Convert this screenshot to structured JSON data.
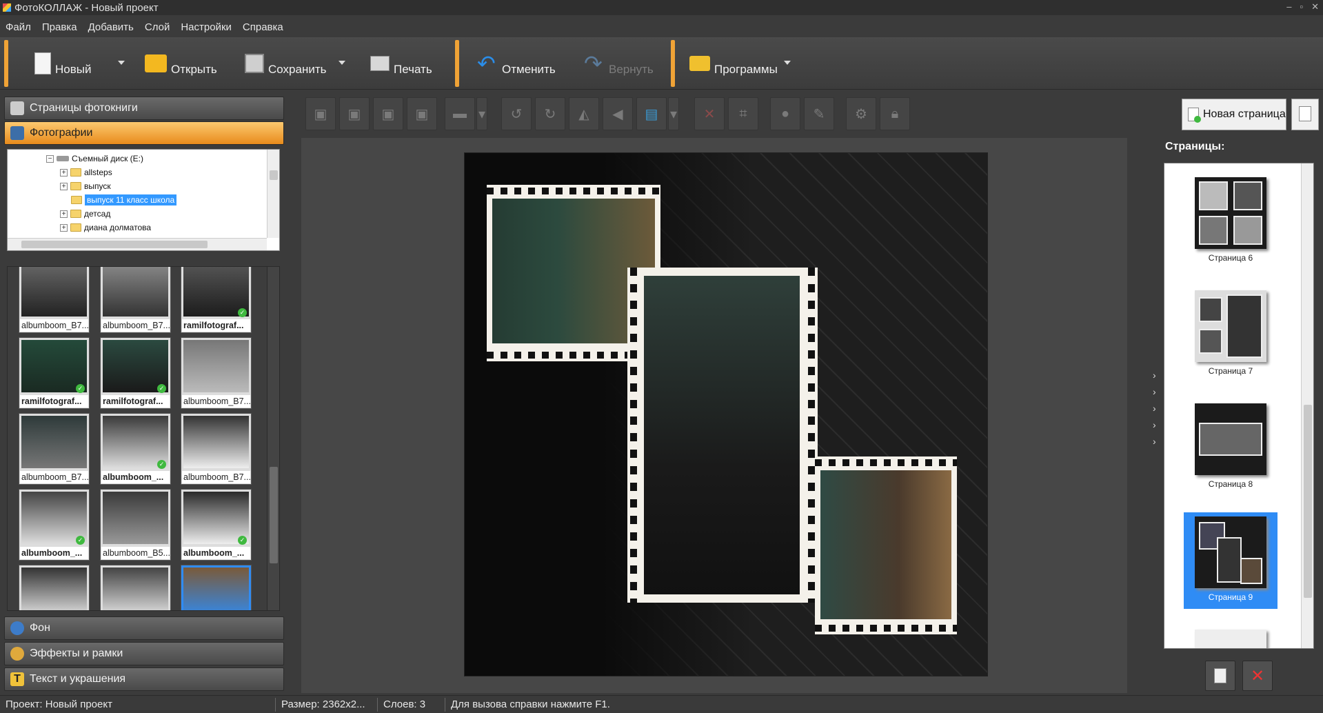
{
  "window": {
    "title": "ФотоКОЛЛАЖ - Новый проект"
  },
  "menu": [
    "Файл",
    "Правка",
    "Добавить",
    "Слой",
    "Настройки",
    "Справка"
  ],
  "toolbar": {
    "new": "Новый",
    "open": "Открыть",
    "save": "Сохранить",
    "print": "Печать",
    "undo": "Отменить",
    "redo": "Вернуть",
    "programs": "Программы"
  },
  "left_panel": {
    "sections": {
      "pages": "Страницы фотокниги",
      "photos": "Фотографии",
      "background": "Фон",
      "effects": "Эффекты и рамки",
      "text": "Текст и украшения"
    },
    "tree": {
      "drive": "Съемный диск (E:)",
      "folders": [
        "allsteps",
        "выпуск",
        "выпуск 11 класс школа",
        "детсад",
        "диана долматова"
      ],
      "selected": "выпуск 11 класс школа"
    },
    "thumbnails": [
      {
        "caption": "albumboom_B7...",
        "bold": false,
        "used": false
      },
      {
        "caption": "albumboom_B7...",
        "bold": false,
        "used": false
      },
      {
        "caption": "ramilfotograf...",
        "bold": true,
        "used": true
      },
      {
        "caption": "ramilfotograf...",
        "bold": true,
        "used": true
      },
      {
        "caption": "ramilfotograf...",
        "bold": true,
        "used": true
      },
      {
        "caption": "albumboom_B7...",
        "bold": false,
        "used": false
      },
      {
        "caption": "albumboom_B7...",
        "bold": false,
        "used": false
      },
      {
        "caption": "albumboom_...",
        "bold": true,
        "used": true
      },
      {
        "caption": "albumboom_B7...",
        "bold": false,
        "used": false
      },
      {
        "caption": "albumboom_...",
        "bold": true,
        "used": true
      },
      {
        "caption": "albumboom_B5...",
        "bold": false,
        "used": false
      },
      {
        "caption": "albumboom_...",
        "bold": true,
        "used": true
      },
      {
        "caption": "",
        "bold": false,
        "used": true
      },
      {
        "caption": "",
        "bold": false,
        "used": true
      },
      {
        "caption": "",
        "bold": false,
        "used": true
      }
    ]
  },
  "right_panel": {
    "new_page": "Новая страница",
    "pages_title": "Страницы:",
    "pages": [
      "Страница 6",
      "Страница 7",
      "Страница 8",
      "Страница 9"
    ],
    "selected_page": "Страница 9"
  },
  "status": {
    "project": "Проект:  Новый проект",
    "size": "Размер:  2362x2...",
    "layers": "Слоев:  3",
    "hint": "Для вызова справки нажмите F1."
  },
  "colors": {
    "accent": "#f0a336",
    "selection": "#2f8cf5"
  }
}
